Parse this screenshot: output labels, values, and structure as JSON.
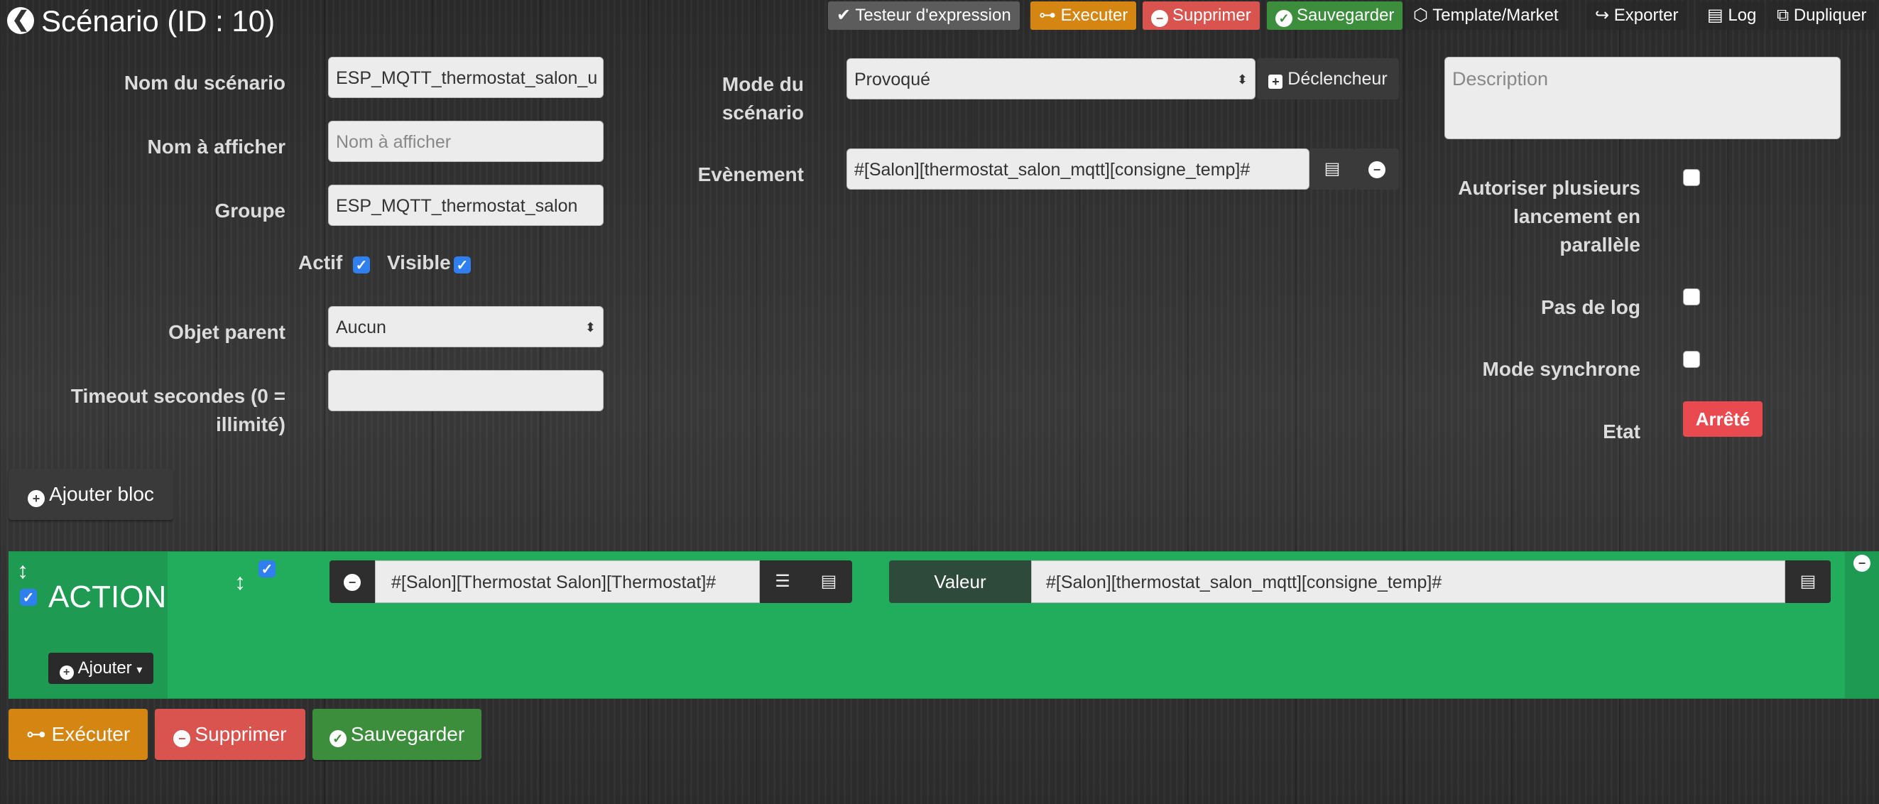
{
  "header": {
    "title": "Scénario (ID : 10)",
    "buttons": {
      "tester": "Testeur d'expression",
      "execute": "Executer",
      "delete": "Supprimer",
      "save": "Sauvegarder",
      "template": "Template/Market",
      "export": "Exporter",
      "log": "Log",
      "duplicate": "Dupliquer"
    }
  },
  "form": {
    "name_label": "Nom du scénario",
    "name_value": "ESP_MQTT_thermostat_salon_u",
    "display_label": "Nom à afficher",
    "display_placeholder": "Nom à afficher",
    "group_label": "Groupe",
    "group_value": "ESP_MQTT_thermostat_salon",
    "active_label": "Actif",
    "visible_label": "Visible",
    "parent_label": "Objet parent",
    "parent_value": "Aucun",
    "timeout_label_1": "Timeout secondes (0 =",
    "timeout_label_2": "illimité)",
    "timeout_value": ""
  },
  "mode": {
    "label_1": "Mode du",
    "label_2": "scénario",
    "value": "Provoqué",
    "trigger_button": "Déclencheur",
    "event_label": "Evènement",
    "event_value": "#[Salon][thermostat_salon_mqtt][consigne_temp]#"
  },
  "options": {
    "description_placeholder": "Description",
    "parallel_label_1": "Autoriser plusieurs",
    "parallel_label_2": "lancement en",
    "parallel_label_3": "parallèle",
    "nolog_label": "Pas de log",
    "sync_label": "Mode synchrone",
    "state_label": "Etat",
    "state_value": "Arrêté"
  },
  "add_block": "Ajouter bloc",
  "block": {
    "title": "ACTION",
    "add_button": "Ajouter",
    "command": "#[Salon][Thermostat Salon][Thermostat]#",
    "value_label": "Valeur",
    "value": "#[Salon][thermostat_salon_mqtt][consigne_temp]#"
  },
  "footer": {
    "execute": "Exécuter",
    "delete": "Supprimer",
    "save": "Sauvegarder"
  },
  "colors": {
    "orange": "#d58512",
    "red": "#d9534f",
    "green": "#3c8d3c",
    "action_green": "#22ad5c",
    "state_red": "#e84a50"
  }
}
